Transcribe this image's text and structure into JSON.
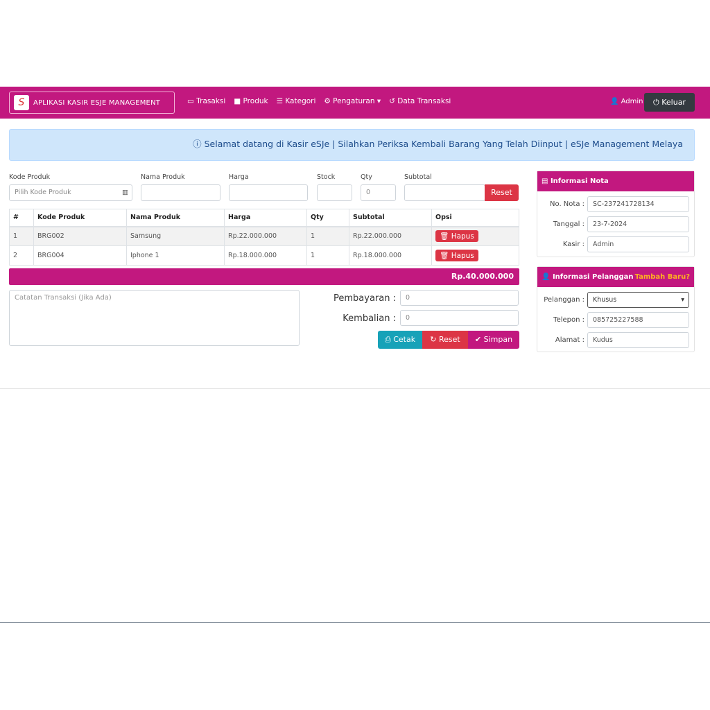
{
  "navbar": {
    "brand": "APLIKASI KASIR ESJE MANAGEMENT",
    "links": [
      "Trasaksi",
      "Produk",
      "Kategori",
      "Pengaturan",
      "Data Transaksi"
    ],
    "user": "Admin",
    "logout": "Keluar"
  },
  "alert": "Selamat datang di Kasir eSJe | Silahkan Periksa Kembali Barang Yang Telah Diinput | eSJe Management Melaya",
  "form": {
    "labels": [
      "Kode Produk",
      "Nama Produk",
      "Harga",
      "Stock",
      "Qty",
      "Subtotal"
    ],
    "kode_placeholder": "Pilih Kode Produk",
    "qty": "0",
    "reset": "Reset"
  },
  "table": {
    "headers": [
      "#",
      "Kode Produk",
      "Nama Produk",
      "Harga",
      "Qty",
      "Subtotal",
      "Opsi"
    ],
    "rows": [
      [
        "1",
        "BRG002",
        "Samsung",
        "Rp.22.000.000",
        "1",
        "Rp.22.000.000",
        "Hapus"
      ],
      [
        "2",
        "BRG004",
        "Iphone 1",
        "Rp.18.000.000",
        "1",
        "Rp.18.000.000",
        "Hapus"
      ]
    ]
  },
  "total": "Rp.40.000.000",
  "catatan_placeholder": "Catatan Transaksi (Jika Ada)",
  "payment": {
    "pembayaran_label": "Pembayaran :",
    "pembayaran": "0",
    "kembalian_label": "Kembalian :",
    "kembalian": "0",
    "cetak": "Cetak",
    "reset": "Reset",
    "simpan": "Simpan"
  },
  "nota": {
    "title": "Informasi Nota",
    "fields": [
      [
        "No. Nota :",
        "SC-237241728134"
      ],
      [
        "Tanggal :",
        "23-7-2024"
      ],
      [
        "Kasir :",
        "Admin"
      ]
    ]
  },
  "pelanggan": {
    "title": "Informasi Pelanggan",
    "add": "Tambah Baru?",
    "fields": [
      [
        "Pelanggan :",
        "Khusus"
      ],
      [
        "Telepon :",
        "085725227588"
      ],
      [
        "Alamat :",
        "Kudus"
      ]
    ]
  }
}
